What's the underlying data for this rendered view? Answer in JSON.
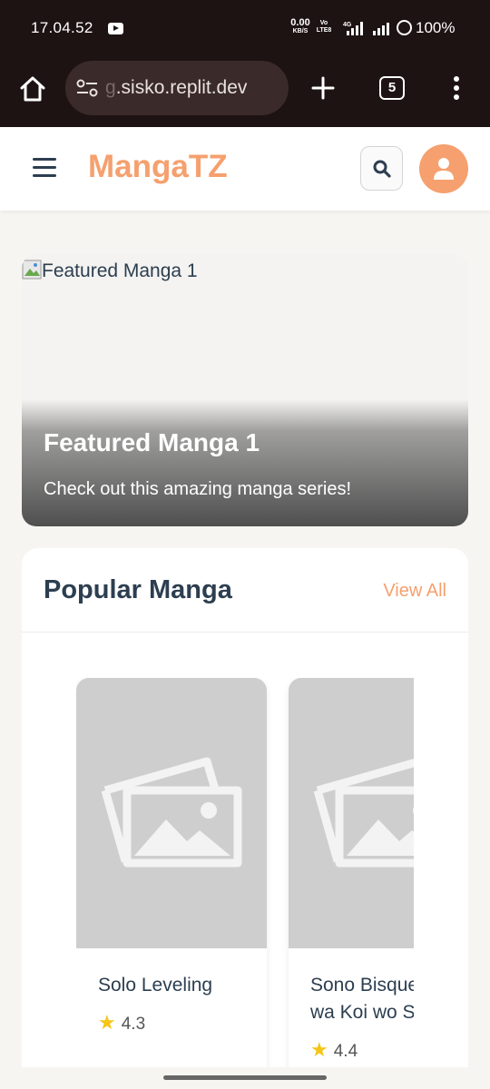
{
  "status_bar": {
    "time": "17.04.52",
    "net_speed": "0.00",
    "net_unit": "KB/S",
    "volte_top": "Vo",
    "volte_bottom": "LTE8",
    "network": "4G",
    "battery": "100%"
  },
  "browser": {
    "url_fade": "g",
    "url": ".sisko.replit.dev",
    "tab_count": "5"
  },
  "header": {
    "brand": "MangaTZ",
    "brand_color": "#f5a06e"
  },
  "featured": {
    "image_alt": "Featured Manga 1",
    "title": "Featured Manga 1",
    "subtitle": "Check out this amazing manga series!"
  },
  "popular": {
    "title": "Popular Manga",
    "view_all": "View All",
    "items": [
      {
        "title": "Solo Leveling",
        "rating": "4.3"
      },
      {
        "title": "Sono Bisque Doll wa Koi wo Suru",
        "rating": "4.4"
      }
    ]
  },
  "colors": {
    "accent": "#f5a06e",
    "text_dark": "#2c3e50",
    "star": "#f5c518"
  }
}
